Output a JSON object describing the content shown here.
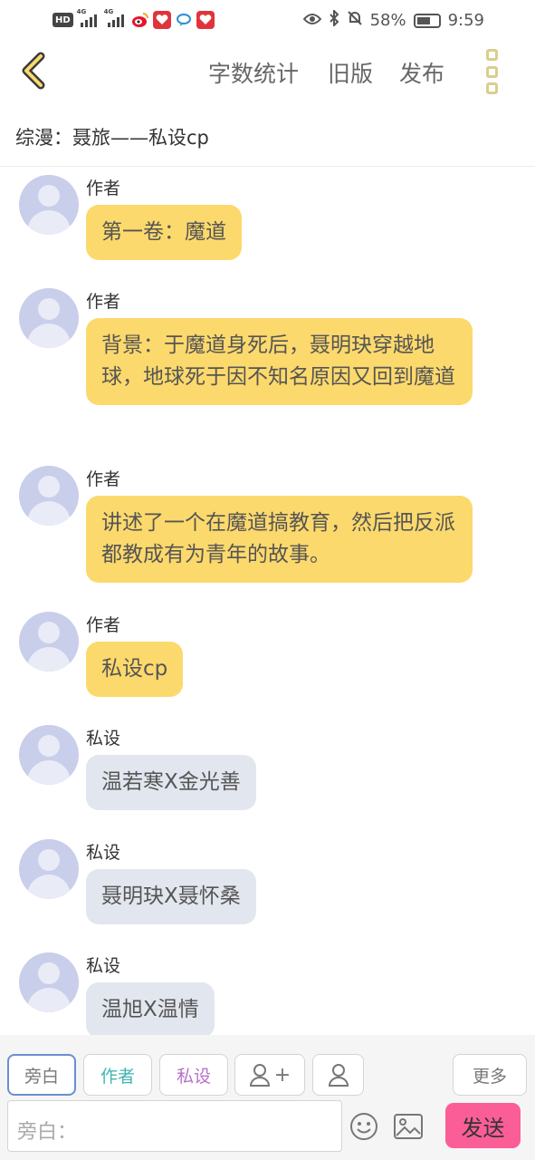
{
  "status_bar": {
    "hd_label": "HD",
    "network_1": "4G",
    "network_2": "4G",
    "battery_text": "58%",
    "time": "9:59",
    "icons": [
      "hd-icon",
      "signal-icon",
      "signal-icon",
      "weibo-icon",
      "app-icon",
      "chat-app-icon",
      "app-icon",
      "eye-icon",
      "bluetooth-icon",
      "mute-icon",
      "battery-icon"
    ]
  },
  "nav": {
    "word_count": "字数统计",
    "old_version": "旧版",
    "publish": "发布"
  },
  "title": "综漫：聂旅——私设cp",
  "messages": [
    {
      "sender": "作者",
      "role": "author",
      "text": "第一卷：魔道"
    },
    {
      "sender": "作者",
      "role": "author",
      "text": "背景：于魔道身死后，聂明玦穿越地球，地球死于因不知名原因又回到魔道"
    },
    {
      "sender": "作者",
      "role": "author",
      "text": "讲述了一个在魔道搞教育，然后把反派都教成有为青年的故事。"
    },
    {
      "sender": "作者",
      "role": "author",
      "text": "私设cp"
    },
    {
      "sender": "私设",
      "role": "private",
      "text": "温若寒X金光善"
    },
    {
      "sender": "私设",
      "role": "private",
      "text": "聂明玦X聂怀桑"
    },
    {
      "sender": "私设",
      "role": "private",
      "text": "温旭X温情"
    }
  ],
  "roles": {
    "narration": "旁白",
    "author": "作者",
    "private": "私设",
    "add_role_plus": "+",
    "more": "更多"
  },
  "input": {
    "placeholder": "旁白："
  },
  "send_label": "发送",
  "colors": {
    "author_bubble": "#fcd96c",
    "private_bubble": "#e2e6ef",
    "send_button": "#fb5e97",
    "author_chip": "#3fb7b3",
    "private_chip": "#b672c8"
  }
}
